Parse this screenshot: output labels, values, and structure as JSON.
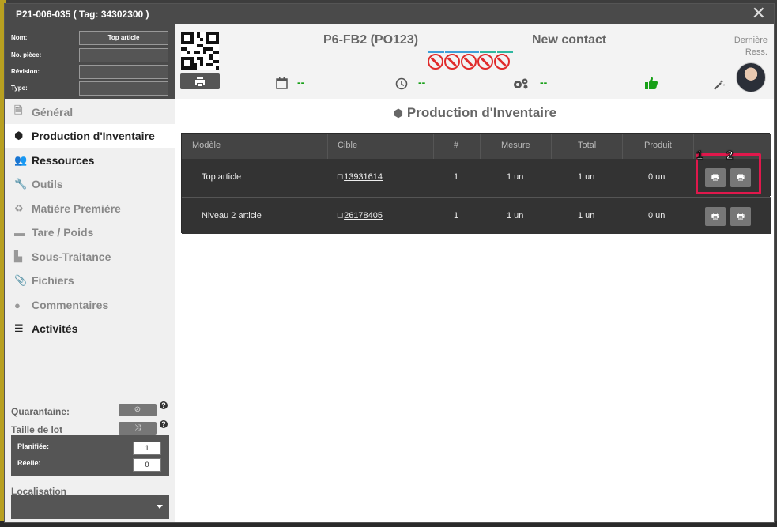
{
  "window": {
    "title": "P21-006-035 ( Tag: 34302300 )"
  },
  "fields": [
    {
      "label": "Nom:",
      "value": "Top article"
    },
    {
      "label": "No. pièce:",
      "value": ""
    },
    {
      "label": "Révision:",
      "value": ""
    },
    {
      "label": "Type:",
      "value": ""
    }
  ],
  "header": {
    "order": "P6-FB2 (PO123)",
    "contact": "New contact",
    "date_value": "--",
    "time_value": "--",
    "settings_value": "--",
    "last_label": "Dernière Ress."
  },
  "sidebar": {
    "items": [
      {
        "label": "Général",
        "icon": "file-icon"
      },
      {
        "label": "Production d'Inventaire",
        "icon": "cube-icon"
      },
      {
        "label": "Ressources",
        "icon": "users-icon"
      },
      {
        "label": "Outils",
        "icon": "wrench-icon"
      },
      {
        "label": "Matière Première",
        "icon": "recycle-icon"
      },
      {
        "label": "Tare / Poids",
        "icon": "box-icon"
      },
      {
        "label": "Sous-Traitance",
        "icon": "factory-icon"
      },
      {
        "label": "Fichiers",
        "icon": "paperclip-icon"
      },
      {
        "label": "Commentaires",
        "icon": "comment-icon"
      },
      {
        "label": "Activités",
        "icon": "list-icon"
      }
    ],
    "quarantaine_label": "Quarantaine:",
    "taille_label": "Taille de lot",
    "planifiee_label": "Planifiée:",
    "planifiee_value": "1",
    "reelle_label": "Réelle:",
    "reelle_value": "0",
    "localisation_label": "Localisation"
  },
  "main": {
    "title": "Production d'Inventaire",
    "columns": [
      "Modèle",
      "Cible",
      "#",
      "Mesure",
      "Total",
      "Produit"
    ],
    "rows": [
      {
        "modele": "Top article",
        "cible": "13931614",
        "num": "1",
        "mesure": "1 un",
        "total": "1 un",
        "produit": "0 un"
      },
      {
        "modele": "Niveau 2 article",
        "cible": "26178405",
        "num": "1",
        "mesure": "1 un",
        "total": "1 un",
        "produit": "0 un"
      }
    ],
    "badge1": "1",
    "badge2": "2"
  },
  "colors": {
    "accent_green": "#18a018",
    "highlight": "#e0184c",
    "stop_red": "#e02b2b"
  }
}
